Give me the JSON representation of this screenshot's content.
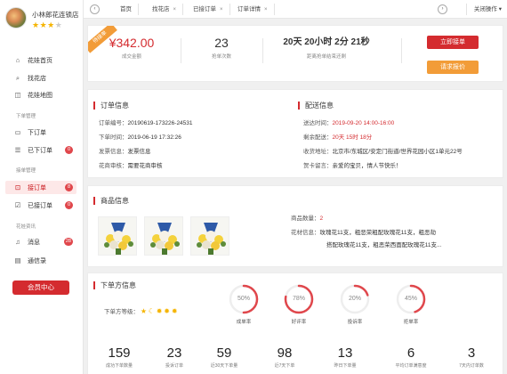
{
  "shop": {
    "name": "小林郎花连锁店",
    "rating": 3,
    "max_rating": 5
  },
  "sidebar": {
    "items": [
      {
        "label": "花娃首页",
        "icon": "home-icon"
      },
      {
        "label": "找花店",
        "icon": "search-icon"
      },
      {
        "label": "花娃地图",
        "icon": "map-icon"
      }
    ],
    "sections": {
      "orders": "下单管理",
      "accept": "接单管理",
      "news": "花娃资讯"
    },
    "order_items": [
      {
        "label": "下订单",
        "icon": "document-icon"
      },
      {
        "label": "已下订单",
        "icon": "document-list-icon",
        "badge": "0"
      }
    ],
    "accept_items": [
      {
        "label": "接订单",
        "icon": "inbox-icon",
        "badge": "8"
      },
      {
        "label": "已接订单",
        "icon": "check-document-icon",
        "badge": "0"
      }
    ],
    "news_items": [
      {
        "label": "消息",
        "icon": "bell-icon",
        "badge": "28"
      },
      {
        "label": "通信录",
        "icon": "contacts-icon"
      }
    ],
    "vip_label": "会员中心"
  },
  "tabs": {
    "items": [
      {
        "label": "首页",
        "closable": false
      },
      {
        "label": "找花店",
        "closable": true
      },
      {
        "label": "已接订单",
        "closable": true
      },
      {
        "label": "订单详情",
        "closable": true
      }
    ],
    "close_ops": "关闭操作 ▾"
  },
  "summary": {
    "ribbon": "待接单",
    "amount": "¥342.00",
    "amount_label": "成交金额",
    "count": "23",
    "count_label": "抢单次数",
    "countdown": "20天 20小时 2分 21秒",
    "countdown_label": "距离抢单结束还剩",
    "accept_button": "立即接单",
    "quote_button": "请求报价"
  },
  "order_info": {
    "title": "订单信息",
    "number_label": "订单编号：",
    "number": "20190619-173226-24531",
    "time_label": "下单时间：",
    "time": "2019-06-19 17:32:26",
    "invoice_label": "发票信息：",
    "invoice": "发票信息",
    "review_label": "花商审核：",
    "review": "需要花商审核"
  },
  "delivery": {
    "title": "配送信息",
    "time_label": "送达时间：",
    "time": "2019-09-20 14:00-16:00",
    "remaining_label": "剩余配送：",
    "remaining": "20天 15时 18分",
    "address_label": "收货地址：",
    "address": "北京市/东城区/安定门街道/世界花园小区1单元22号",
    "card_label": "贺卡留言：",
    "card": "亲爱的宝贝，情人节快乐！"
  },
  "goods": {
    "title": "商品信息",
    "qty_label": "商品数量：",
    "qty": "2",
    "material_label": "花材信息：",
    "material_line1": "玫瑰花11支，粗恶荣粗配玫瑰花11支，粗恶劫",
    "material_line2": "搭配玫瑰花11支，粗恶荣西面配玫瑰花11支..."
  },
  "buyer": {
    "title": "下单方信息",
    "level_label": "下单方等级：",
    "level_icons": [
      "star-icon",
      "moon-icon",
      "sun-icon",
      "sun-icon",
      "sun-icon"
    ],
    "gauges": [
      {
        "value": "50%",
        "percent": 50,
        "label": "成单率"
      },
      {
        "value": "78%",
        "percent": 78,
        "label": "好评率"
      },
      {
        "value": "20%",
        "percent": 20,
        "label": "投诉率"
      },
      {
        "value": "45%",
        "percent": 45,
        "label": "拒单率"
      }
    ],
    "stats": [
      {
        "value": "159",
        "label": "成功下单数量"
      },
      {
        "value": "23",
        "label": "投诉订单"
      },
      {
        "value": "59",
        "label": "近30天下单量"
      },
      {
        "value": "98",
        "label": "近7天下单"
      },
      {
        "value": "13",
        "label": "昨日下单量"
      },
      {
        "value": "6",
        "label": "平均订单满意度"
      },
      {
        "value": "3",
        "label": "7天内订单数"
      }
    ]
  },
  "colors": {
    "primary": "#d42b2f",
    "accent": "#f29c38",
    "star": "#f5b400"
  }
}
